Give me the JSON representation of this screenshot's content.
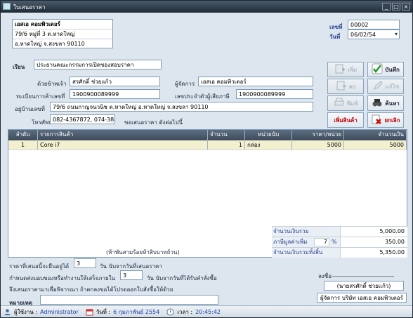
{
  "window": {
    "title": "ใบเสนอราคา",
    "controls": [
      "_",
      "□",
      "×"
    ]
  },
  "company": {
    "name": "เอสเอ คอมพิวเตอร์",
    "address1": "79/6 หมู่ที่ 3 ต.หาดใหญ่",
    "address2": "อ.หาดใหญ่ จ.สงขลา 90110"
  },
  "doc": {
    "number_label": "เลขที่",
    "number": "00002",
    "date_label": "วันที่",
    "date": "06/02/54"
  },
  "form": {
    "to_label": "เรียน",
    "to": "ประธานคณะกรรมการเปิดซองสอบราคา",
    "by_label": "ด้วยข้าพเจ้า",
    "by": "สรศักดิ์ ช่วยแก้ว",
    "manager_label": "ผู้จัดการ",
    "manager": "เอสเอ คอมพิวเตอร์",
    "reg_label": "ทะเบียนการค้าเลขที่",
    "reg": "1900900089999",
    "tax_label": "เลขประจำตัวผู้เสียภาษี",
    "tax": "1900900089999",
    "house_label": "อยู่บ้านเลขที่",
    "house": "79/6 ถนนกาญจนวนิช ต.หาดใหญ่ อ.หาดใหญ่ จ.สงขลา 90110",
    "phone_label": "โทรศัพท์",
    "phone": "082-4367872, 074-3841",
    "offer_text": "ขอเสนอราคา ดังต่อไปนี้"
  },
  "buttons": {
    "add": "เพิ่ม",
    "save": "บันทึก",
    "delete": "ลบ",
    "edit": "แก้ไข",
    "print": "พิมพ์",
    "search": "ค้นหา",
    "add_product": "เพิ่มสินค้า",
    "cancel": "ยกเลิก"
  },
  "table": {
    "headers": [
      "ลำดับ",
      "รายการสินค้า",
      "จำนวน",
      "หน่วยนับ",
      "ราคา/หน่วย",
      "จำนวนเงิน"
    ],
    "rows": [
      {
        "no": "1",
        "item": "Core i7",
        "qty": "1",
        "unit": "กล่อง",
        "price": "5000",
        "amount": "5000"
      }
    ]
  },
  "totals": {
    "subtotal_label": "จำนวนเงินรวม",
    "subtotal": "5,000.00",
    "vat_label": "ภาษีมูลค่าเพิ่ม",
    "vat_rate": "7",
    "vat_pct": "%",
    "vat": "350.00",
    "grand_label": "จำนวนเงินรวมทั้งสิ้น",
    "grand": "5,350.00",
    "in_words": "(ห้าพันสามร้อยห้าสิบบาทถ้วน)"
  },
  "terms": {
    "valid_pre": "ราคาที่เสนอนี้จะยืนอยู่ได้",
    "valid_days": "3",
    "valid_post": "วัน นับจากวันที่เสนอราคา",
    "delivery_pre": "กำหนดส่งมอบของหรือทำงานให้เสร็จภายใน",
    "delivery_days": "3",
    "delivery_post": "วัน นับจากวันที่ได้รับคำสั่งซื้อ",
    "closing": "จึงเสนอราคามาเพื่อพิจารณา ถ้าตกลงขอได้โปรดออกใบสั่งซื้อให้ด้วย",
    "note_label": "หมายเหตุ",
    "note": ""
  },
  "signature": {
    "sign_label": "ลงชื่อ",
    "line": "______________________",
    "name": "(นายสรศักดิ์ ช่วยแก้ว)",
    "position": "ผู้จัดการ บริษัท เอสเอ คอมพิวเตอร์"
  },
  "status": {
    "user_label": "ผู้ใช้งาน :",
    "user": "Administrator",
    "date_label": "วันที่ :",
    "date": "6 กุมภาพันธ์ 2554",
    "time_label": "เวลา :",
    "time": "20:45:42"
  }
}
